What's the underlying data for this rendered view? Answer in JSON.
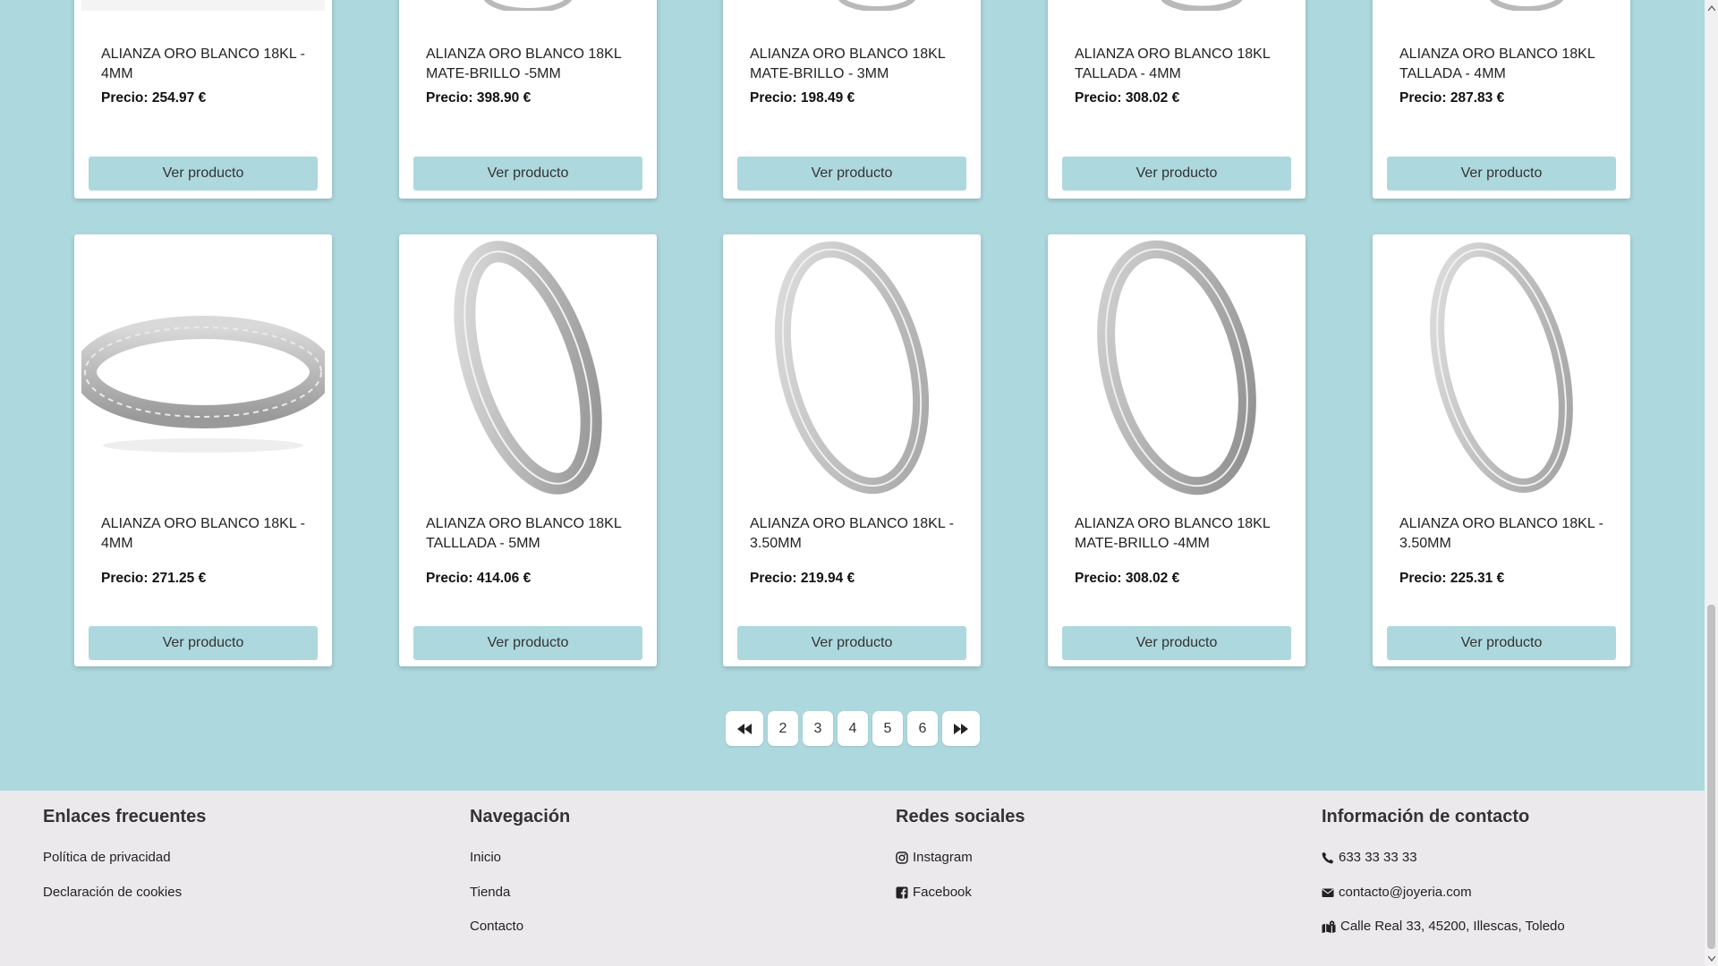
{
  "products_row1": [
    {
      "name": "ALIANZA ORO BLANCO 18KL - 4MM",
      "price": "Precio: 254.97 €",
      "button": "Ver producto"
    },
    {
      "name": "ALIANZA ORO BLANCO 18KL MATE-BRILLO -5MM",
      "price": "Precio: 398.90 €",
      "button": "Ver producto"
    },
    {
      "name": "ALIANZA ORO BLANCO 18KL MATE-BRILLO - 3MM",
      "price": "Precio: 198.49 €",
      "button": "Ver producto"
    },
    {
      "name": "ALIANZA ORO BLANCO 18KL TALLADA - 4MM",
      "price": "Precio: 308.02 €",
      "button": "Ver producto"
    },
    {
      "name": "ALIANZA ORO BLANCO 18KL TALLADA - 4MM",
      "price": "Precio: 287.83 €",
      "button": "Ver producto"
    }
  ],
  "products_row2": [
    {
      "name": "ALIANZA ORO BLANCO 18KL - 4MM",
      "price": "Precio: 271.25 €",
      "button": "Ver producto"
    },
    {
      "name": "ALIANZA ORO BLANCO 18KL TALLLADA - 5MM",
      "price": "Precio: 414.06 €",
      "button": "Ver producto"
    },
    {
      "name": "ALIANZA ORO BLANCO 18KL - 3.50MM",
      "price": "Precio: 219.94 €",
      "button": "Ver producto"
    },
    {
      "name": "ALIANZA ORO BLANCO 18KL MATE-BRILLO -4MM",
      "price": "Precio: 308.02 €",
      "button": "Ver producto"
    },
    {
      "name": "ALIANZA ORO BLANCO 18KL - 3.50MM",
      "price": "Precio: 225.31 €",
      "button": "Ver producto"
    }
  ],
  "pagination": {
    "first_icon": "double-chevron-left-icon",
    "pages": [
      "2",
      "3",
      "4",
      "5",
      "6"
    ],
    "last_icon": "double-chevron-right-icon"
  },
  "footer": {
    "links": {
      "title": "Enlaces frecuentes",
      "items": [
        "Política de privacidad",
        "Declaración de cookies"
      ]
    },
    "nav": {
      "title": "Navegación",
      "items": [
        "Inicio",
        "Tienda",
        "Contacto"
      ]
    },
    "social": {
      "title": "Redes sociales",
      "items": [
        {
          "label": "Instagram",
          "icon": "instagram-icon"
        },
        {
          "label": "Facebook",
          "icon": "facebook-icon"
        }
      ]
    },
    "contact": {
      "title": "Información de contacto",
      "items": [
        {
          "label": "633 33 33 33",
          "icon": "phone-icon"
        },
        {
          "label": "contacto@joyeria.com",
          "icon": "envelope-icon"
        },
        {
          "label": "Calle Real 33, 45200, Illescas, Toledo",
          "icon": "map-location-icon"
        }
      ]
    }
  },
  "colors": {
    "page_bg": "#add8de",
    "button_bg": "#add8de",
    "footer_bg": "#ebe9eb",
    "card_bg": "#ffffff"
  }
}
